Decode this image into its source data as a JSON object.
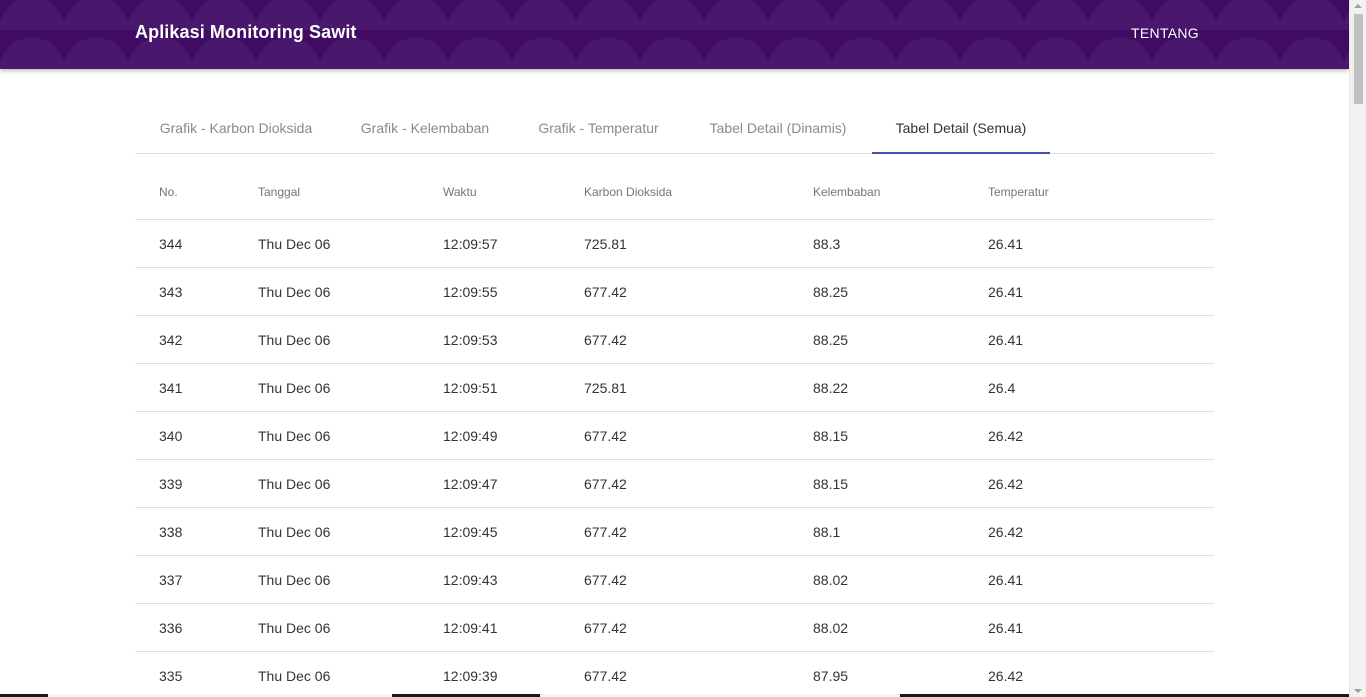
{
  "header": {
    "brand": "Aplikasi Monitoring Sawit",
    "nav_about": "TENTANG"
  },
  "tabs": [
    {
      "label": "Grafik - Karbon Dioksida"
    },
    {
      "label": "Grafik - Kelembaban"
    },
    {
      "label": "Grafik - Temperatur"
    },
    {
      "label": "Tabel Detail (Dinamis)"
    },
    {
      "label": "Tabel Detail (Semua)",
      "active": true
    }
  ],
  "table": {
    "columns": [
      "No.",
      "Tanggal",
      "Waktu",
      "Karbon Dioksida",
      "Kelembaban",
      "Temperatur"
    ],
    "rows": [
      [
        "344",
        "Thu Dec 06",
        "12:09:57",
        "725.81",
        "88.3",
        "26.41"
      ],
      [
        "343",
        "Thu Dec 06",
        "12:09:55",
        "677.42",
        "88.25",
        "26.41"
      ],
      [
        "342",
        "Thu Dec 06",
        "12:09:53",
        "677.42",
        "88.25",
        "26.41"
      ],
      [
        "341",
        "Thu Dec 06",
        "12:09:51",
        "725.81",
        "88.22",
        "26.4"
      ],
      [
        "340",
        "Thu Dec 06",
        "12:09:49",
        "677.42",
        "88.15",
        "26.42"
      ],
      [
        "339",
        "Thu Dec 06",
        "12:09:47",
        "677.42",
        "88.15",
        "26.42"
      ],
      [
        "338",
        "Thu Dec 06",
        "12:09:45",
        "677.42",
        "88.1",
        "26.42"
      ],
      [
        "337",
        "Thu Dec 06",
        "12:09:43",
        "677.42",
        "88.02",
        "26.41"
      ],
      [
        "336",
        "Thu Dec 06",
        "12:09:41",
        "677.42",
        "88.02",
        "26.41"
      ],
      [
        "335",
        "Thu Dec 06",
        "12:09:39",
        "677.42",
        "87.95",
        "26.42"
      ]
    ]
  },
  "colors": {
    "navbar": "#3f0b63",
    "tab_indicator": "#3f51b5"
  }
}
